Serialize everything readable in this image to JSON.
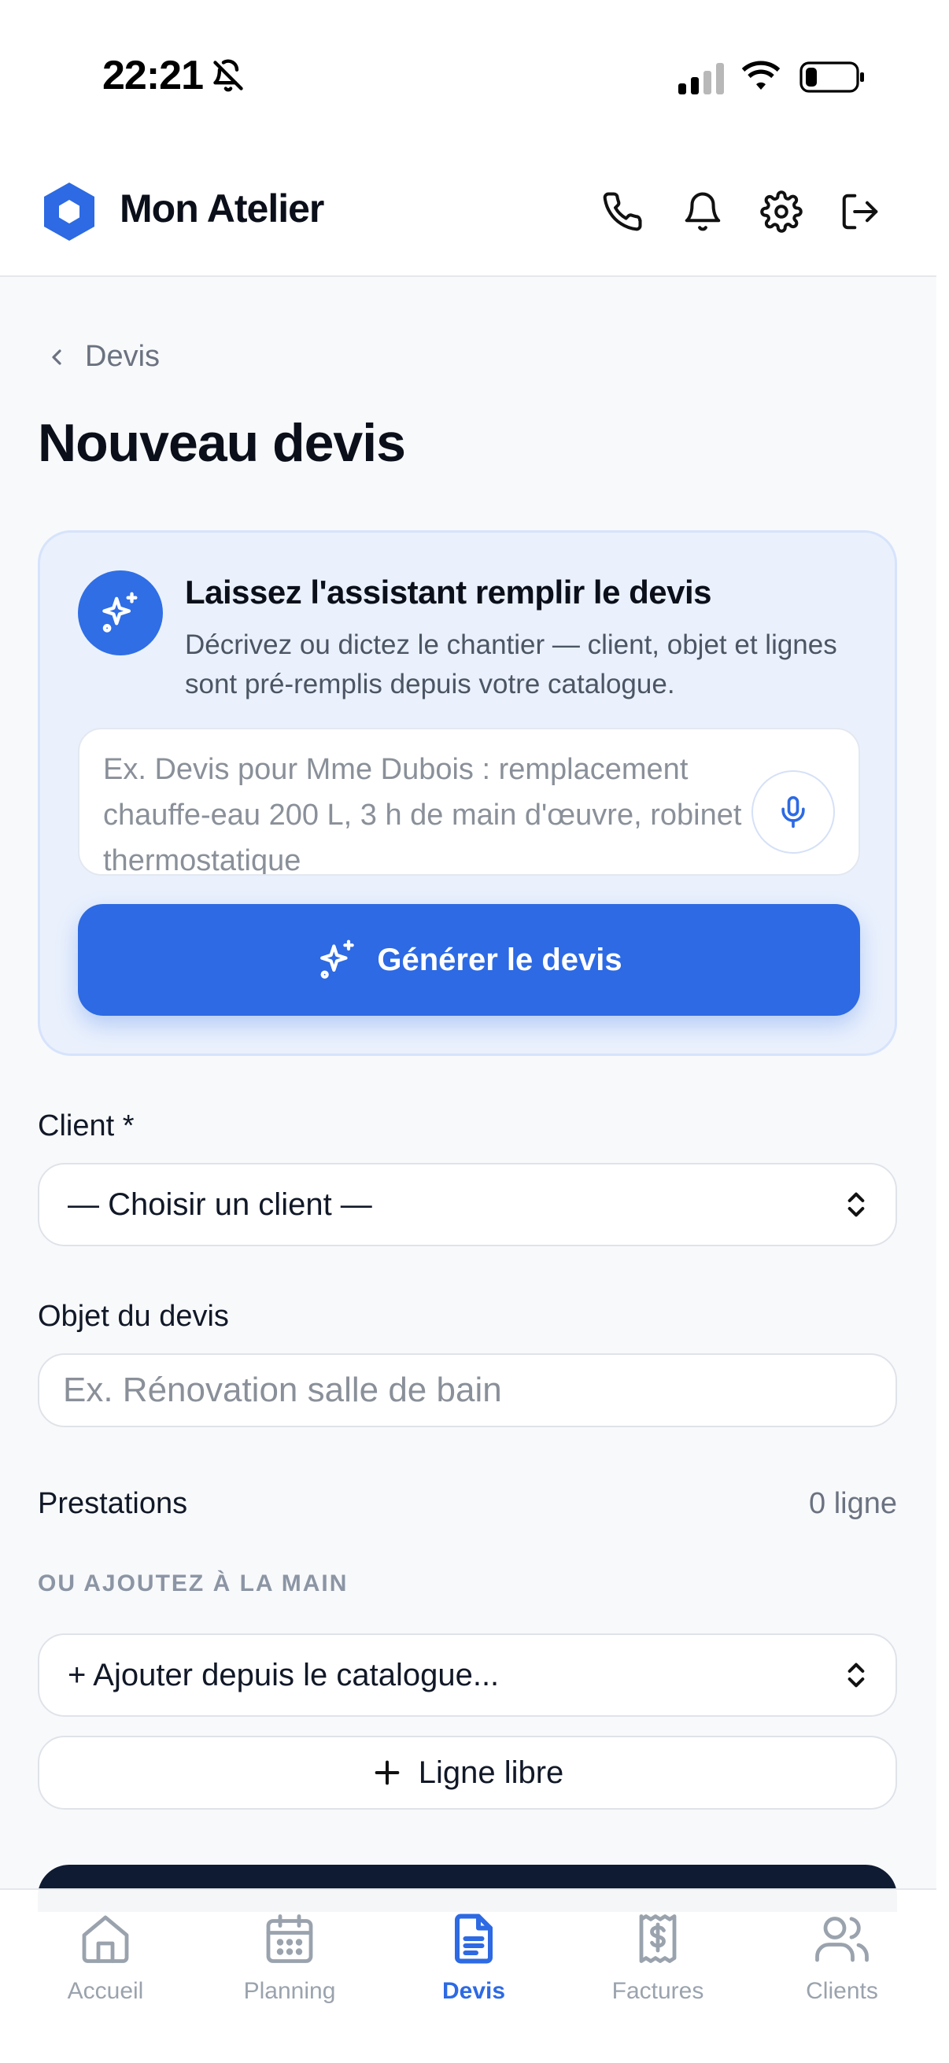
{
  "status_bar": {
    "time": "22:21"
  },
  "header": {
    "app_title": "Mon Atelier",
    "icons": [
      "phone-icon",
      "bell-icon",
      "settings-icon",
      "logout-icon"
    ]
  },
  "breadcrumb": {
    "label": "Devis"
  },
  "page": {
    "title": "Nouveau devis"
  },
  "assistant": {
    "title": "Laissez l'assistant remplir le devis",
    "description": "Décrivez ou dictez le chantier — client, objet et lignes sont pré-remplis depuis votre catalogue.",
    "placeholder": "Ex. Devis pour Mme Dubois : remplacement chauffe-eau 200 L, 3 h de main d'œuvre, robinet thermostatique",
    "generate_label": "Générer le devis"
  },
  "form": {
    "client_label": "Client *",
    "client_select": "— Choisir un client —",
    "object_label": "Objet du devis",
    "object_placeholder": "Ex. Rénovation salle de bain"
  },
  "prestations": {
    "title": "Prestations",
    "count": "0 ligne",
    "hint": "OU AJOUTEZ À LA MAIN",
    "catalogue_select": "+ Ajouter depuis le catalogue...",
    "free_line_label": "Ligne libre"
  },
  "nav": {
    "items": [
      {
        "label": "Accueil",
        "icon": "home-icon"
      },
      {
        "label": "Planning",
        "icon": "calendar-icon"
      },
      {
        "label": "Devis",
        "icon": "document-icon",
        "active": true
      },
      {
        "label": "Factures",
        "icon": "receipt-icon"
      },
      {
        "label": "Clients",
        "icon": "users-icon"
      }
    ]
  },
  "colors": {
    "accent": "#2d6ae3",
    "assistant_bg": "#eaf1fd",
    "text": "#0b0f1a",
    "muted": "#8a9099",
    "dark_bar": "#0f1b33"
  }
}
